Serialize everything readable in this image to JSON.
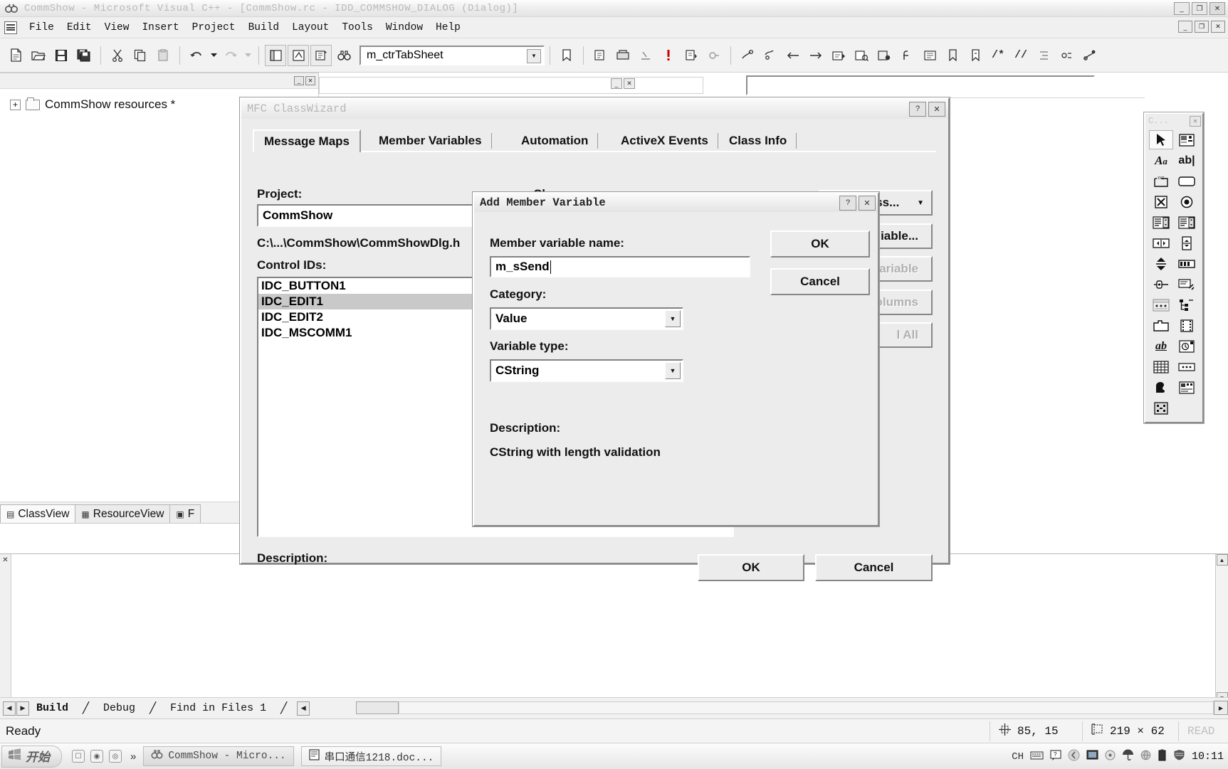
{
  "window": {
    "title": "CommShow - Microsoft Visual C++ - [CommShow.rc - IDD_COMMSHOW_DIALOG (Dialog)]",
    "app_icon": "vc-binoculars-icon",
    "minimize": "_",
    "maximize": "❐",
    "close": "✕"
  },
  "menu": {
    "items": [
      "File",
      "Edit",
      "View",
      "Insert",
      "Project",
      "Build",
      "Layout",
      "Tools",
      "Window",
      "Help"
    ],
    "doc_minimize": "_",
    "doc_restore": "❐",
    "doc_close": "✕"
  },
  "toolbar": {
    "combo_value": "m_ctrTabSheet",
    "combo_arrow": "▼"
  },
  "workspace": {
    "tree_root": "CommShow resources *",
    "expander": "+",
    "tabs": [
      {
        "label": "ClassView",
        "icon": "classview-icon",
        "active": true
      },
      {
        "label": "ResourceView",
        "icon": "resourceview-icon",
        "active": false
      },
      {
        "label": "F",
        "icon": "fileview-icon",
        "active": false
      }
    ]
  },
  "classwizard": {
    "title": "MFC ClassWizard",
    "help_btn": "?",
    "close_btn": "✕",
    "tabs": [
      {
        "label": "Message Maps",
        "active": true
      },
      {
        "label": "Member Variables",
        "active": false
      },
      {
        "label": "Automation",
        "active": false
      },
      {
        "label": "ActiveX Events",
        "active": false
      },
      {
        "label": "Class Info",
        "active": false
      }
    ],
    "project_label": "Project:",
    "project_value": "CommShow",
    "class_name_label": "Class name:",
    "class_name_value": "",
    "file_path": "C:\\...\\CommShow\\CommShowDlg.h",
    "control_ids_label": "Control IDs:",
    "control_ids": [
      {
        "id": "IDC_BUTTON1",
        "selected": false
      },
      {
        "id": "IDC_EDIT1",
        "selected": true
      },
      {
        "id": "IDC_EDIT2",
        "selected": false
      },
      {
        "id": "IDC_MSCOMM1",
        "selected": false
      }
    ],
    "description_label": "Description:",
    "side_buttons": [
      {
        "label": "Add Class...",
        "split": true,
        "disabled": false,
        "arrow": "▼"
      },
      {
        "label": "iable...",
        "split": false,
        "disabled": false
      },
      {
        "label": "ariable",
        "split": false,
        "disabled": true
      },
      {
        "label": "olumns",
        "split": false,
        "disabled": true
      },
      {
        "label": "l All",
        "split": false,
        "disabled": true
      }
    ],
    "ok_label": "OK",
    "cancel_label": "Cancel"
  },
  "add_member_variable": {
    "title": "Add Member Variable",
    "help_btn": "?",
    "close_btn": "✕",
    "name_label": "Member variable name:",
    "name_value": "m_sSend",
    "category_label": "Category:",
    "category_value": "Value",
    "variable_type_label": "Variable type:",
    "variable_type_value": "CString",
    "description_label": "Description:",
    "description_text": "CString with length validation",
    "ok_label": "OK",
    "cancel_label": "Cancel",
    "combo_arrow": "▼"
  },
  "toolbox": {
    "title": "C...",
    "close": "✕",
    "tools": [
      {
        "name": "select-pointer-tool",
        "selected": true
      },
      {
        "name": "picture-tool",
        "selected": false
      },
      {
        "name": "static-text-tool",
        "selected": false
      },
      {
        "name": "edit-box-tool",
        "selected": false
      },
      {
        "name": "group-box-tool",
        "selected": false
      },
      {
        "name": "button-tool",
        "selected": false
      },
      {
        "name": "check-box-tool",
        "selected": false
      },
      {
        "name": "radio-button-tool",
        "selected": false
      },
      {
        "name": "combo-box-tool",
        "selected": false
      },
      {
        "name": "list-box-tool",
        "selected": false
      },
      {
        "name": "horizontal-scrollbar-tool",
        "selected": false
      },
      {
        "name": "vertical-scrollbar-tool",
        "selected": false
      },
      {
        "name": "spin-tool",
        "selected": false
      },
      {
        "name": "progress-tool",
        "selected": false
      },
      {
        "name": "slider-tool",
        "selected": false
      },
      {
        "name": "hotkey-tool",
        "selected": false
      },
      {
        "name": "list-control-tool",
        "selected": false
      },
      {
        "name": "tree-control-tool",
        "selected": false
      },
      {
        "name": "tab-control-tool",
        "selected": false
      },
      {
        "name": "animate-tool",
        "selected": false
      },
      {
        "name": "rich-edit-tool",
        "selected": false
      },
      {
        "name": "date-time-picker-tool",
        "selected": false
      },
      {
        "name": "month-calendar-tool",
        "selected": false
      },
      {
        "name": "ip-address-tool",
        "selected": false
      },
      {
        "name": "custom-control-tool",
        "selected": false
      },
      {
        "name": "extended-combo-tool",
        "selected": false
      },
      {
        "name": "activex-control-tool",
        "selected": false
      }
    ]
  },
  "output": {
    "tabs": [
      {
        "label": "Build",
        "active": true
      },
      {
        "label": "Debug",
        "active": false
      },
      {
        "label": "Find in Files 1",
        "active": false
      }
    ],
    "nav_first": "◀",
    "nav_prev": "▶",
    "nav_more": "◀"
  },
  "statusbar": {
    "ready": "Ready",
    "cursor_icon": "crosshair-position-icon",
    "cursor_pos": "85, 15",
    "size_icon": "selection-size-icon",
    "size": "219 × 62",
    "read_indicator": "READ"
  },
  "taskbar": {
    "start_label": "开始",
    "start_icon": "windows-flag-icon",
    "quick_launch": [
      "show-desktop-icon",
      "media-player-icon",
      "browser-icon"
    ],
    "chevron": "»",
    "items": [
      {
        "label": "CommShow - Micro...",
        "icon": "vc-app-icon",
        "active": true
      },
      {
        "label": "串口通信1218.doc...",
        "icon": "word-doc-icon",
        "active": false
      }
    ],
    "tray": [
      "CH",
      "keyboard-icon",
      "help-icon",
      "back-icon",
      "display-icon",
      "sound-icon",
      "umbrella-icon",
      "globe-icon",
      "battery-icon",
      "shield-icon"
    ],
    "clock": "10:11"
  }
}
